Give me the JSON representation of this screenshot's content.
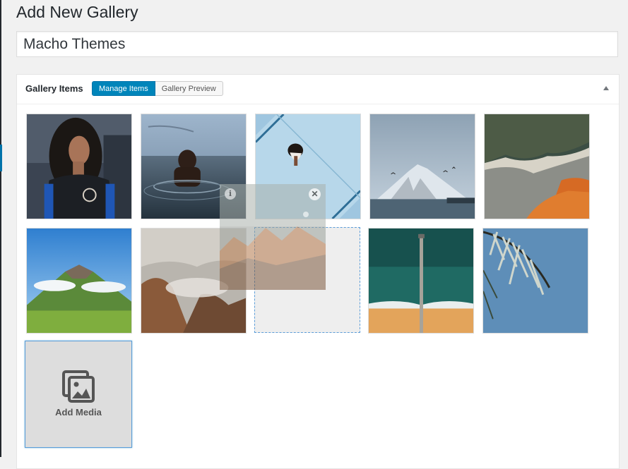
{
  "page": {
    "title": "Add New Gallery"
  },
  "title_field": {
    "value": "Macho Themes"
  },
  "gallery_box": {
    "title": "Gallery Items",
    "tabs": [
      {
        "label": "Manage Items",
        "active": true
      },
      {
        "label": "Gallery Preview",
        "active": false
      }
    ],
    "toggle_icon": "arrow-up-icon"
  },
  "items": [
    {
      "name": "woman-portrait"
    },
    {
      "name": "man-in-water"
    },
    {
      "name": "pool-aerial"
    },
    {
      "name": "snowy-mountain"
    },
    {
      "name": "coast-aerial"
    },
    {
      "name": "green-volcano"
    },
    {
      "name": "foggy-cliffs"
    },
    {
      "name": "ocean-pier"
    },
    {
      "name": "palm-leaf"
    }
  ],
  "dragging_item": {
    "name": "mountain-range",
    "info_icon": "info-icon",
    "close_icon": "close-icon"
  },
  "add_media": {
    "label": "Add Media",
    "icon": "media-gallery-icon"
  },
  "colors": {
    "accent": "#0085ba",
    "placeholder_border": "#5b9dd9"
  }
}
